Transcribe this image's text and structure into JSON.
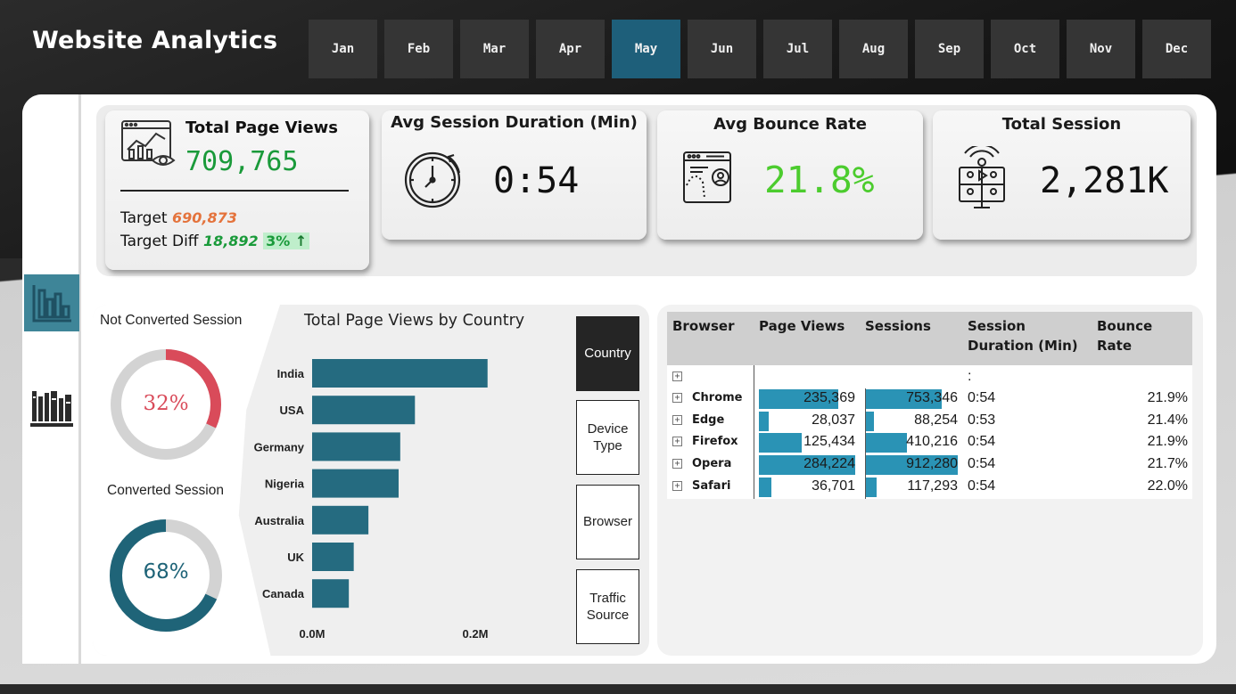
{
  "header": {
    "title": "Website Analytics",
    "months": [
      "Jan",
      "Feb",
      "Mar",
      "Apr",
      "May",
      "Jun",
      "Jul",
      "Aug",
      "Sep",
      "Oct",
      "Nov",
      "Dec"
    ],
    "selected_month": "May"
  },
  "colors": {
    "accent": "#1e5f7a",
    "positive": "#1a9a3a",
    "target": "#e4733c",
    "bounce": "#4ccc2e",
    "not_converted": "#d94b5a",
    "converted": "#1f6478",
    "bar": "#2a93b5"
  },
  "kpis": {
    "page_views": {
      "title": "Total Page Views",
      "value": "709,765",
      "target_label": "Target",
      "target_value": "690,873",
      "diff_label": "Target Diff",
      "diff_value": "18,892",
      "diff_pct": "3%",
      "diff_arrow": "↑"
    },
    "session_duration": {
      "title": "Avg Session Duration (Min)",
      "value": "0:54"
    },
    "bounce_rate": {
      "title": "Avg Bounce Rate",
      "value": "21.8%"
    },
    "total_session": {
      "title": "Total Session",
      "value": "2,281K"
    }
  },
  "donuts": {
    "not_converted": {
      "label": "Not Converted Session",
      "value": "32%",
      "fraction": 0.32
    },
    "converted": {
      "label": "Converted Session",
      "value": "68%",
      "fraction": 0.68
    }
  },
  "slicers": {
    "country": "Country",
    "device_type": "Device Type",
    "browser": "Browser",
    "traffic_source": "Traffic Source",
    "active": "Country"
  },
  "chart_data": {
    "type": "bar",
    "orientation": "horizontal",
    "title": "Total Page Views by Country",
    "categories": [
      "India",
      "USA",
      "Germany",
      "Nigeria",
      "Australia",
      "UK",
      "Canada"
    ],
    "values": [
      215000,
      126000,
      108000,
      106000,
      69000,
      51000,
      45000
    ],
    "xticks": [
      "0.0M",
      "0.2M"
    ],
    "xlim": [
      0,
      200000
    ],
    "grid": false
  },
  "table": {
    "headers": {
      "browser": "Browser",
      "page_views": "Page Views",
      "sessions": "Sessions",
      "duration_l1": "Session",
      "duration_l2": "Duration (Min)",
      "bounce_l1": "Bounce",
      "bounce_l2": "Rate"
    },
    "blank_row": {
      "duration": ":"
    },
    "rows": [
      {
        "browser": "Chrome",
        "page_views": "235,369",
        "page_views_n": 235369,
        "sessions": "753,346",
        "sessions_n": 753346,
        "duration": "0:54",
        "bounce": "21.9%"
      },
      {
        "browser": "Edge",
        "page_views": "28,037",
        "page_views_n": 28037,
        "sessions": "88,254",
        "sessions_n": 88254,
        "duration": "0:53",
        "bounce": "21.4%"
      },
      {
        "browser": "Firefox",
        "page_views": "125,434",
        "page_views_n": 125434,
        "sessions": "410,216",
        "sessions_n": 410216,
        "duration": "0:54",
        "bounce": "21.9%"
      },
      {
        "browser": "Opera",
        "page_views": "284,224",
        "page_views_n": 284224,
        "sessions": "912,280",
        "sessions_n": 912280,
        "duration": "0:54",
        "bounce": "21.7%"
      },
      {
        "browser": "Safari",
        "page_views": "36,701",
        "page_views_n": 36701,
        "sessions": "117,293",
        "sessions_n": 117293,
        "duration": "0:54",
        "bounce": "22.0%"
      }
    ]
  },
  "icons": [
    "page-views-chart-icon",
    "stopwatch-icon",
    "bounce-browser-icon",
    "session-broadcast-icon",
    "bar-chart-nav-icon",
    "library-nav-icon",
    "expand-icon"
  ]
}
